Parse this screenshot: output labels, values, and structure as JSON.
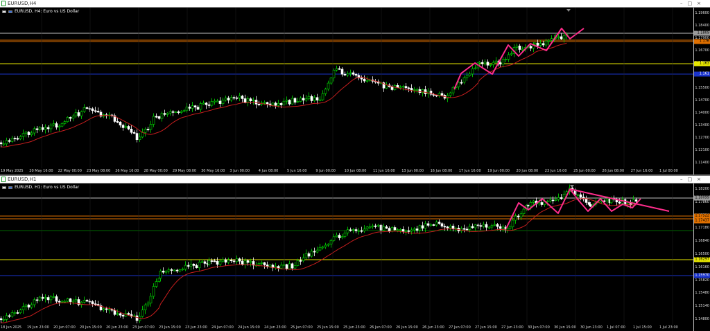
{
  "window": {
    "title": "EURUSD,H4"
  },
  "chart_h4": {
    "window_title": "EURUSD,H4",
    "label": "EURUSD, H4:  Euro vs US Dollar",
    "price_labels": [
      "1.19600",
      "1.18400",
      "1.17900",
      "1.16700",
      "1.16300",
      "1.15900",
      "1.15500",
      "1.14700",
      "1.14000",
      "1.13400",
      "1.12700",
      "1.12100",
      "1.11400"
    ],
    "price_boxes": {
      "white": "1.1809",
      "orange": "1.176",
      "yellow": "1.163",
      "blue": "1.161"
    },
    "time_labels": [
      "19 May 2025",
      "20 May 16:00",
      "22 May 00:00",
      "23 May 08:00",
      "26 May 16:00",
      "28 May 00:00",
      "29 May 08:00",
      "30 May 16:00",
      "3 Jun 00:00",
      "4 Jun 08:00",
      "5 Jun 16:00",
      "9 Jun 00:00",
      "10 Jun 08:00",
      "11 Jun 16:00",
      "13 Jun 00:00",
      "16 Jun 08:00",
      "17 Jun 16:00",
      "19 Jun 00:00",
      "20 Jun 08:00",
      "23 Jun 16:00",
      "25 Jun 00:00",
      "26 Jun 08:00",
      "27 Jun 16:00",
      "1 Jul 00:00"
    ]
  },
  "chart_h1": {
    "window_title": "EURUSD,H1",
    "label": "EURUSD, H1:  Euro vs US Dollar",
    "price_labels": [
      "1.18200",
      "1.17860",
      "1.17520",
      "1.17180",
      "1.16840",
      "1.16500",
      "1.16160",
      "1.15820",
      "1.15480",
      "1.15140",
      "1.14800"
    ],
    "price_boxes": {
      "white": "1.18099",
      "orange1": "1.17522",
      "orange2": "1.17437",
      "yellow": "1.16297",
      "blue": "1.15970"
    },
    "time_labels": [
      "18 Jun 2025",
      "19 Jun 23:00",
      "20 Jun 07:00",
      "20 Jun 15:00",
      "20 Jun 23:00",
      "23 Jun 07:00",
      "23 Jun 15:00",
      "23 Jun 23:00",
      "24 Jun 07:00",
      "24 Jun 15:00",
      "24 Jun 23:00",
      "25 Jun 07:00",
      "25 Jun 15:00",
      "25 Jun 23:00",
      "26 Jun 07:00",
      "26 Jun 15:00",
      "26 Jun 23:00",
      "27 Jun 07:00",
      "27 Jun 15:00",
      "27 Jun 23:00",
      "30 Jun 07:00",
      "30 Jun 15:00",
      "30 Jun 23:00",
      "1 Jul 07:00",
      "1 Jul 15:00",
      "1 Jul 23:00"
    ]
  },
  "colors": {
    "bull": "#00e000",
    "bear": "#ffffff",
    "ma": "#c81e1e",
    "pattern": "#ff2d8c",
    "line_white": "#bfbfbf",
    "line_orange": "#e07000",
    "line_yellow": "#e8e800",
    "line_blue": "#1a33cc"
  },
  "icons": {
    "window_icon": "chart-window-icon",
    "window_buttons": "minimize-maximize-close-icons"
  }
}
